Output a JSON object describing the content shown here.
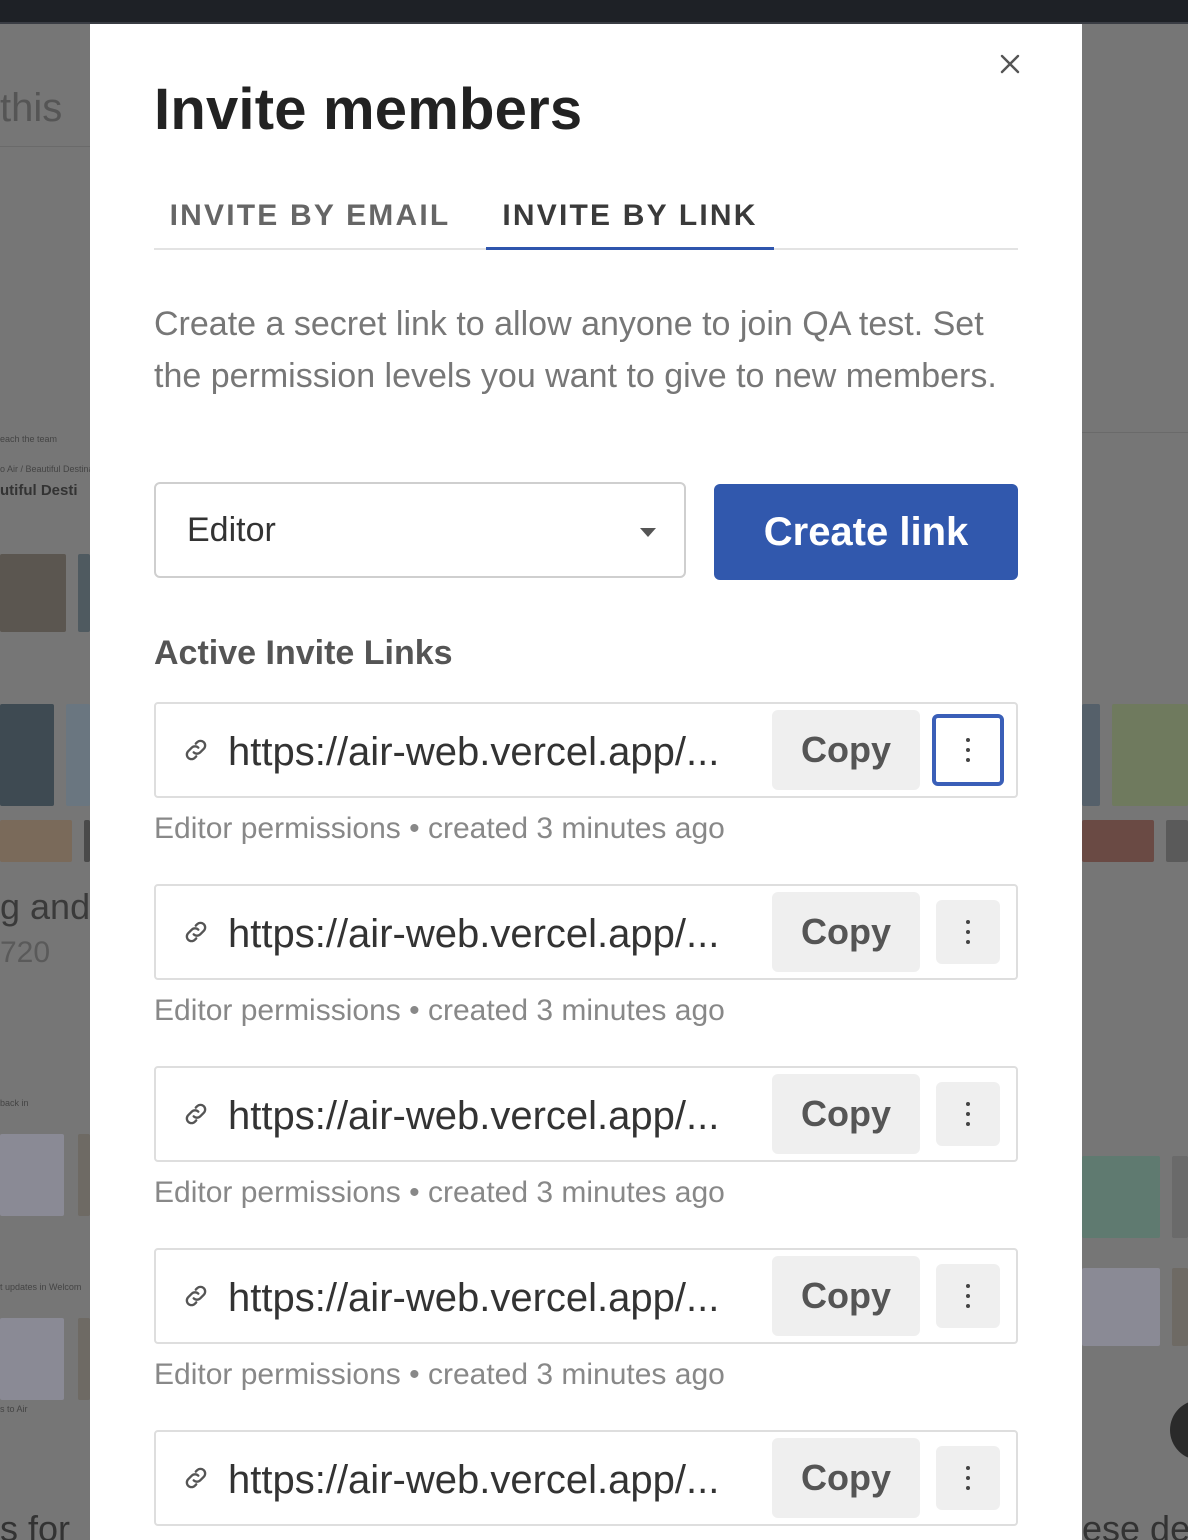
{
  "background": {
    "texts": [
      "this",
      "utiful Desti",
      "g and",
      "720",
      "s for",
      "ese de"
    ],
    "tiny_texts": [
      "each the team",
      "o Air / Beautiful Destinati",
      "back in",
      "t updates in Welcom",
      "s to Air"
    ]
  },
  "modal": {
    "title": "Invite members",
    "close_icon": "close-icon",
    "tabs": [
      {
        "label": "INVITE BY EMAIL",
        "active": false
      },
      {
        "label": "INVITE BY LINK",
        "active": true
      }
    ],
    "description": "Create a secret link to allow anyone to join QA test. Set the permission levels you want to give to new members.",
    "permission_select": {
      "value": "Editor"
    },
    "create_button": "Create link",
    "accent_color": "#3158ad",
    "active_links_title": "Active Invite Links",
    "links": [
      {
        "url": "https://air-web.vercel.app/...",
        "copy_label": "Copy",
        "permissions": "Editor permissions",
        "separator": "•",
        "created": "created 3 minutes ago"
      },
      {
        "url": "https://air-web.vercel.app/...",
        "copy_label": "Copy",
        "permissions": "Editor permissions",
        "separator": "•",
        "created": "created 3 minutes ago"
      },
      {
        "url": "https://air-web.vercel.app/...",
        "copy_label": "Copy",
        "permissions": "Editor permissions",
        "separator": "•",
        "created": "created 3 minutes ago"
      },
      {
        "url": "https://air-web.vercel.app/...",
        "copy_label": "Copy",
        "permissions": "Editor permissions",
        "separator": "•",
        "created": "created 3 minutes ago"
      },
      {
        "url": "https://air-web.vercel.app/...",
        "copy_label": "Copy"
      }
    ]
  }
}
